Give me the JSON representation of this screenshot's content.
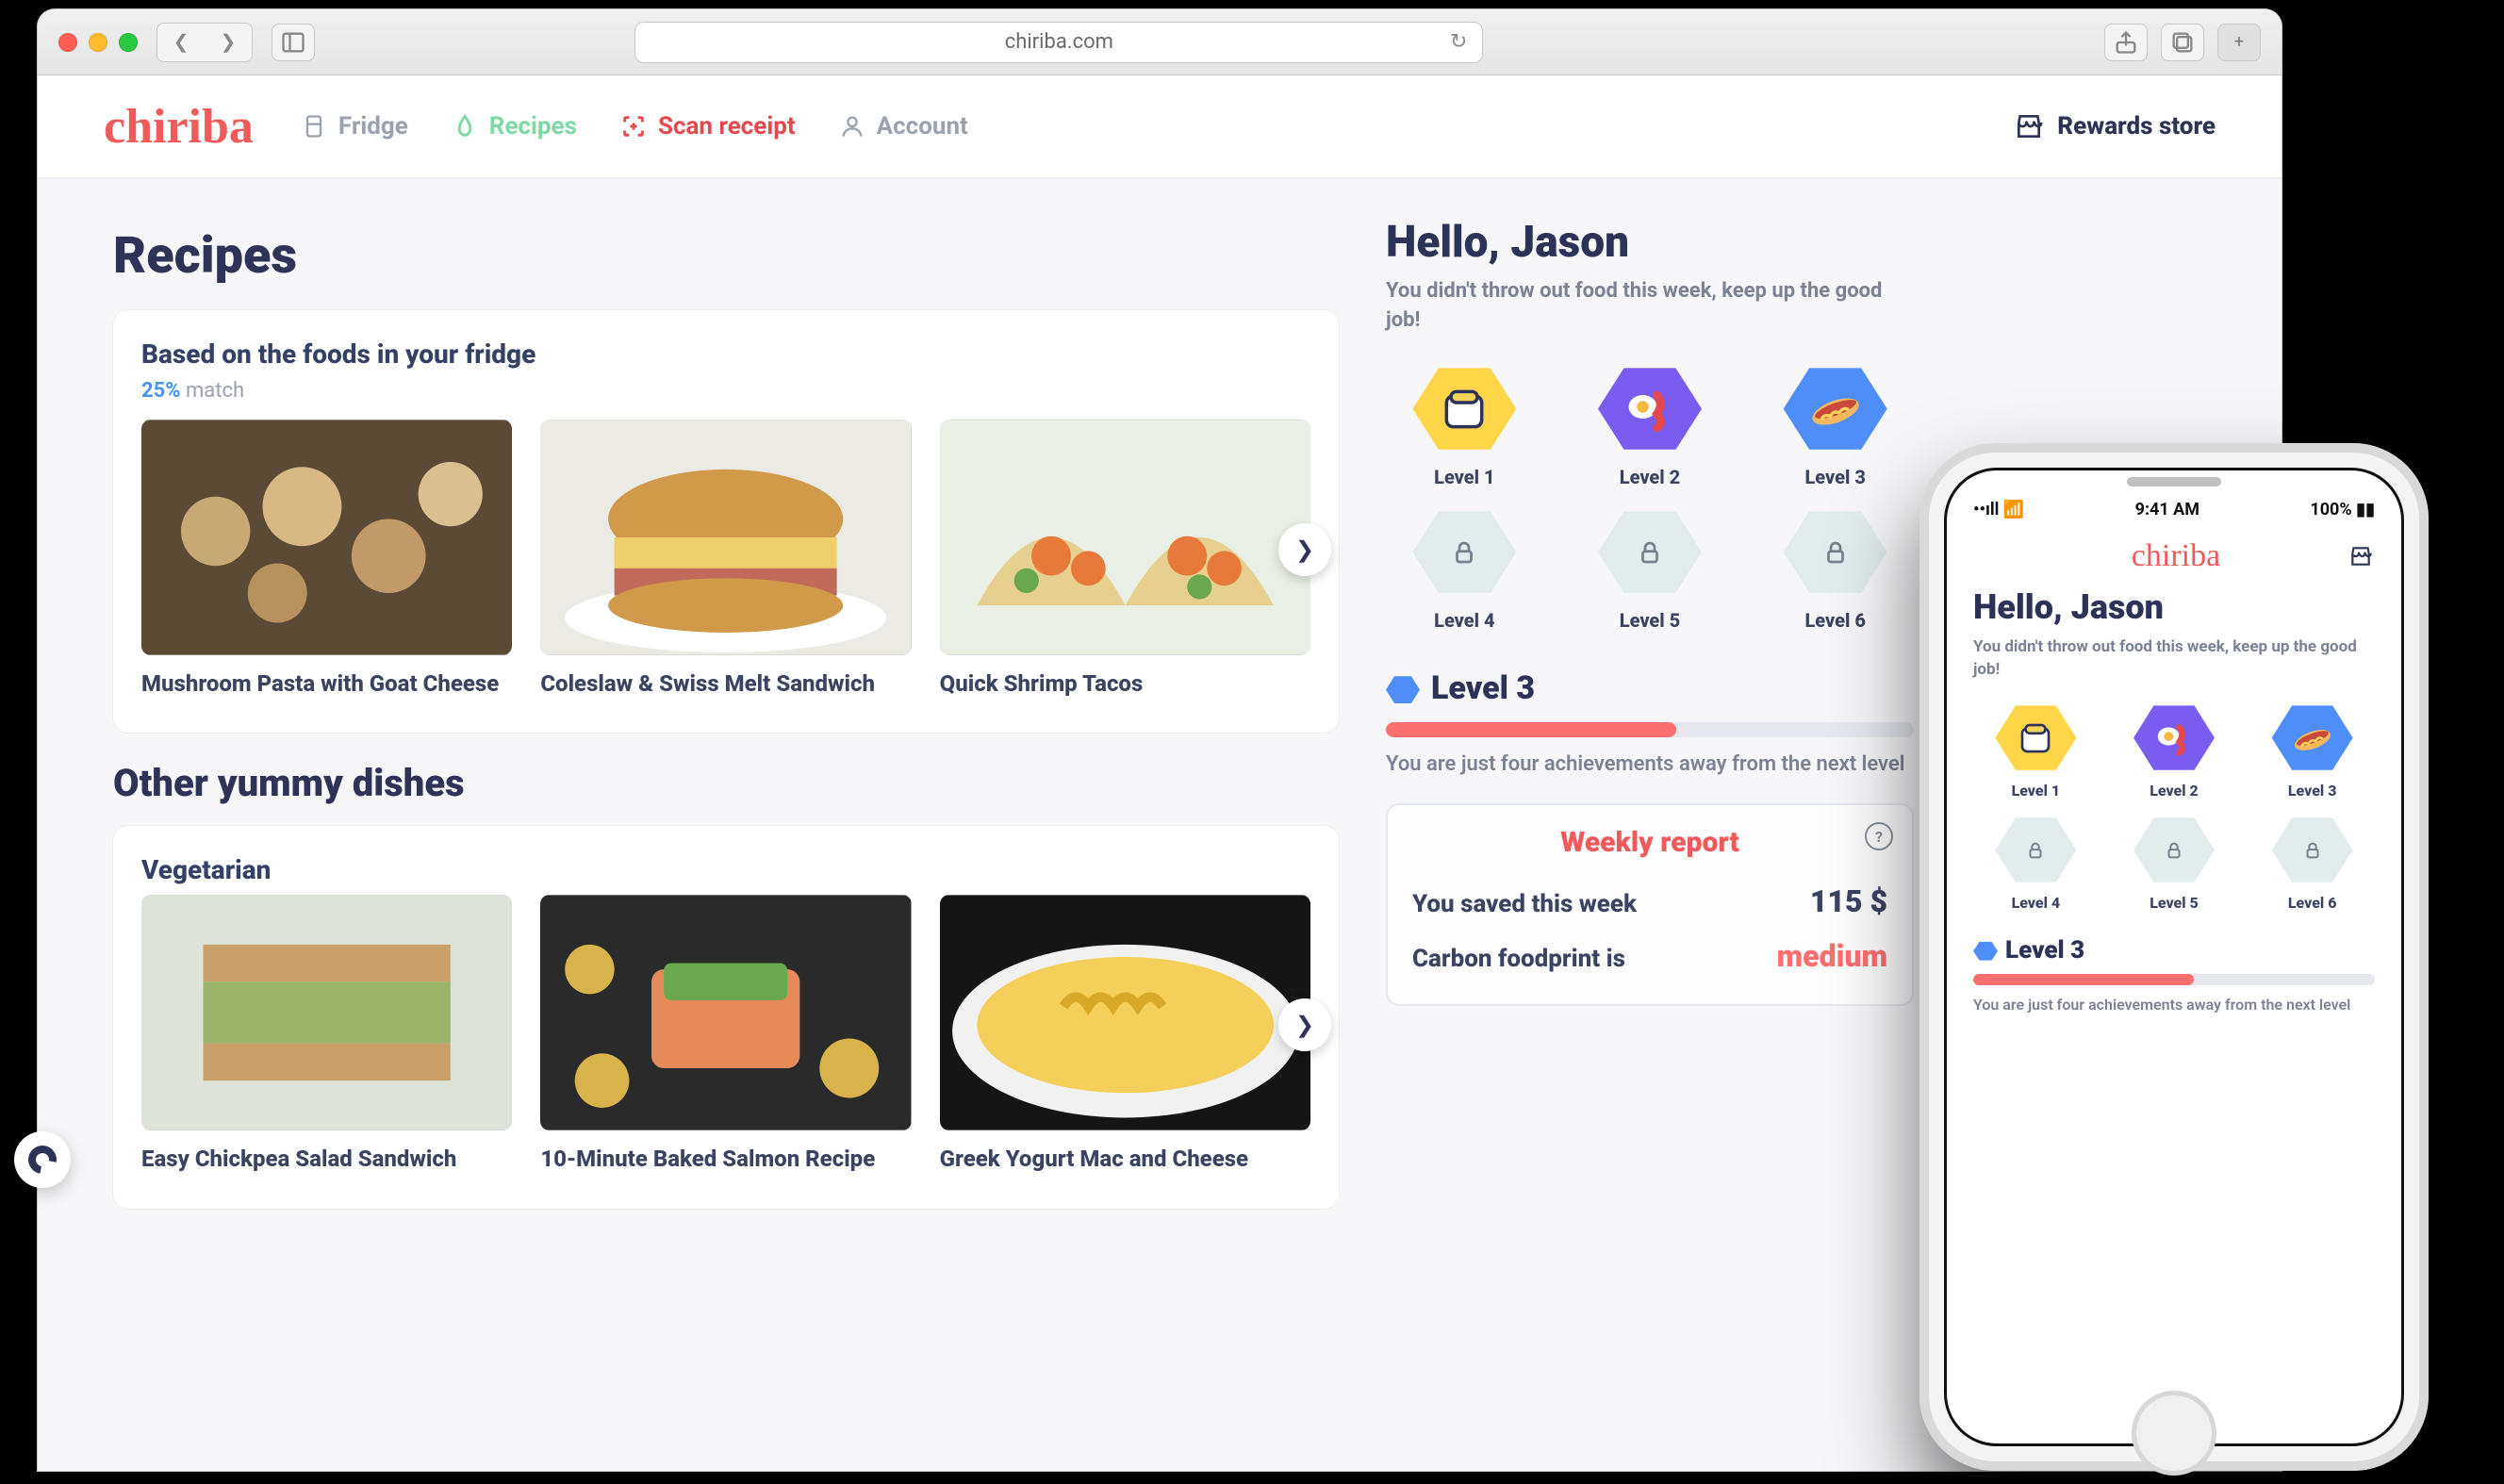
{
  "browser": {
    "url": "chiriba.com"
  },
  "brand": "chiriba",
  "nav": {
    "fridge": "Fridge",
    "recipes": "Recipes",
    "scan": "Scan receipt",
    "account": "Account",
    "rewards": "Rewards store"
  },
  "recipes": {
    "title": "Recipes",
    "fridge_block": {
      "heading": "Based on the foods in your fridge",
      "match_pct": "25%",
      "match_word": "match"
    },
    "fridge_tiles": [
      "Mushroom Pasta with Goat Cheese",
      "Coleslaw & Swiss Melt Sandwich",
      "Quick Shrimp Tacos"
    ],
    "other_heading": "Other yummy dishes",
    "veg_heading": "Vegetarian",
    "veg_tiles": [
      "Easy Chickpea Salad Sandwich",
      "10-Minute Baked Salmon Recipe",
      "Greek Yogurt Mac and Cheese"
    ]
  },
  "sidebar": {
    "hello": "Hello, Jason",
    "hello_sub": "You didn't throw out food this week, keep up the good job!",
    "levels": [
      "Level 1",
      "Level 2",
      "Level 3",
      "Level 4",
      "Level 5",
      "Level 6"
    ],
    "level_head": "Level 3",
    "progress_pct": 55,
    "progress_sub": "You are just four achievements away from the next level",
    "report": {
      "title": "Weekly report",
      "saved_label": "You saved this week",
      "saved_value": "115 $",
      "carbon_label": "Carbon foodprint is",
      "carbon_value": "medium"
    }
  },
  "phone": {
    "status_time": "9:41 AM",
    "status_batt": "100%"
  },
  "colors": {
    "accent_red": "#f05a5a",
    "accent_green": "#7fd9a5",
    "ink": "#2c3258"
  }
}
